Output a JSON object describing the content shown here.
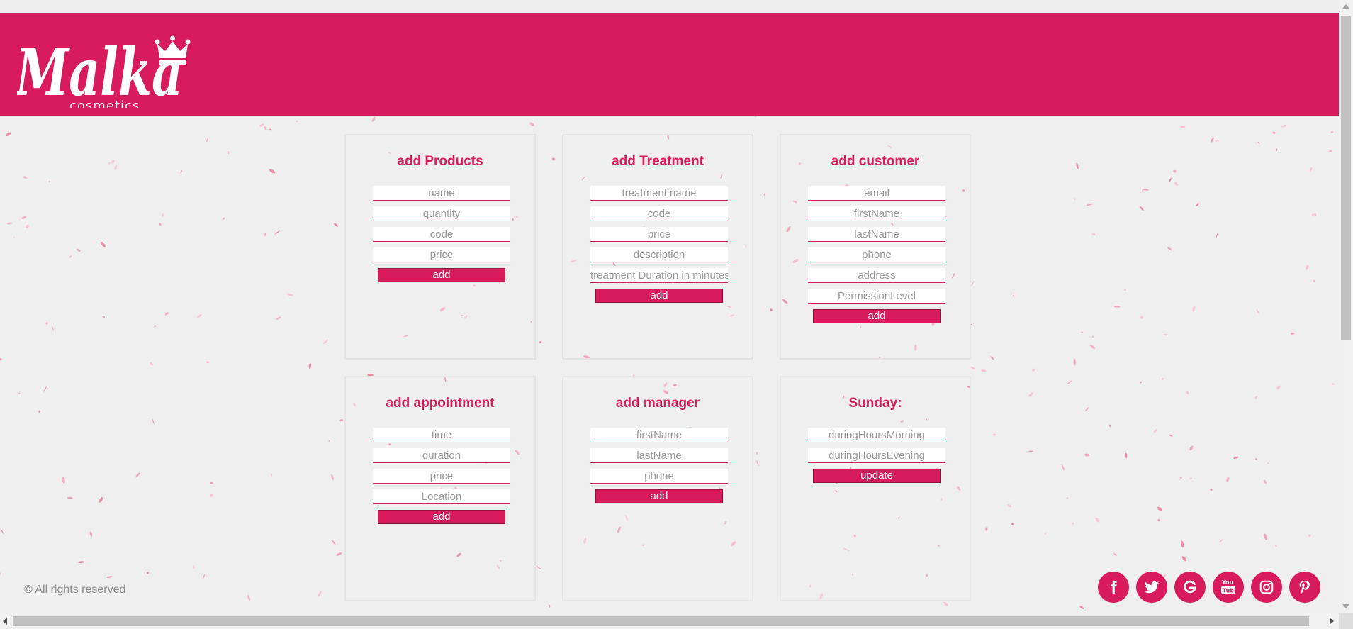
{
  "brand": {
    "logo_text": "Malka",
    "logo_subtext": "cosmetics",
    "primary_color": "#d81b5c"
  },
  "cards": {
    "products": {
      "title": "add Products",
      "fields": [
        "name",
        "quantity",
        "code",
        "price"
      ],
      "button": "add"
    },
    "treatment": {
      "title": "add Treatment",
      "fields": [
        "treatment name",
        "code",
        "price",
        "description",
        "treatment Duration in minutes"
      ],
      "button": "add"
    },
    "customer": {
      "title": "add customer",
      "fields": [
        "email",
        "firstName",
        "lastName",
        "phone",
        "address",
        "PermissionLevel"
      ],
      "button": "add"
    },
    "appointment": {
      "title": "add appointment",
      "fields": [
        "time",
        "duration",
        "price",
        "Location"
      ],
      "button": "add"
    },
    "manager": {
      "title": "add manager",
      "fields": [
        "firstName",
        "lastName",
        "phone"
      ],
      "button": "add"
    },
    "sunday": {
      "title": "Sunday:",
      "fields": [
        "duringHoursMorning",
        "duringHoursEvening"
      ],
      "button": "update"
    }
  },
  "footer": {
    "copyright": "© All rights reserved",
    "social": [
      "facebook-icon",
      "twitter-icon",
      "google-icon",
      "youtube-icon",
      "instagram-icon",
      "pinterest-icon"
    ]
  }
}
